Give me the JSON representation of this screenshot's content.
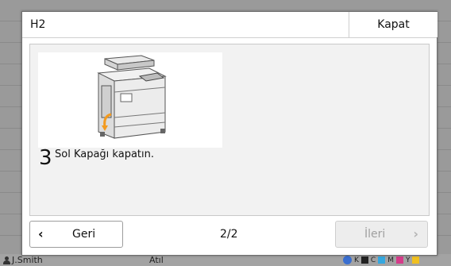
{
  "dialog": {
    "title": "H2",
    "close_label": "Kapat",
    "step_number": "3",
    "step_text": "Sol Kapağı kapatın.",
    "back_label": "Geri",
    "next_label": "İleri",
    "page_indicator": "2/2"
  },
  "background": {
    "user_name": "J.Smith",
    "mode_text": "Atıl",
    "ink_labels": [
      "K",
      "C",
      "M",
      "Y"
    ]
  },
  "colors": {
    "ink_k": "#222222",
    "ink_c": "#35a8e0",
    "ink_m": "#d63c8a",
    "ink_y": "#f0c020",
    "arrow_orange": "#f39a1e"
  }
}
